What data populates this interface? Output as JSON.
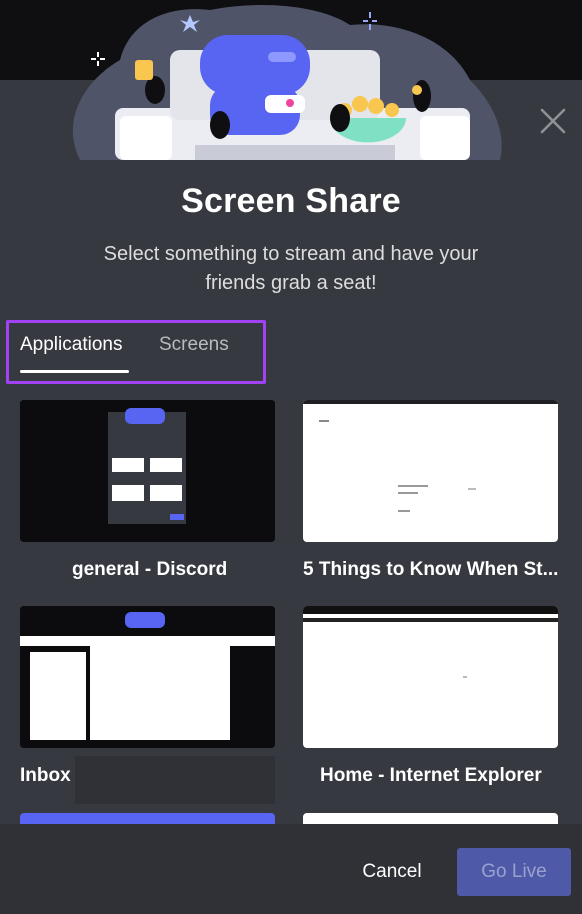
{
  "dialog": {
    "title": "Screen Share",
    "subtitle": "Select something to stream and have your friends grab a seat!"
  },
  "tabs": [
    {
      "label": "Applications",
      "selected": true
    },
    {
      "label": "Screens",
      "selected": false
    }
  ],
  "sources": [
    {
      "label": "general - Discord",
      "thumbnail": "dark"
    },
    {
      "label": "5 Things to Know When St...",
      "thumbnail": "white"
    },
    {
      "label": "Inbox",
      "thumbnail": "dark"
    },
    {
      "label": "Home - Internet Explorer",
      "thumbnail": "white"
    }
  ],
  "footer": {
    "cancel_label": "Cancel",
    "go_live_label": "Go Live"
  },
  "colors": {
    "background": "#36393f",
    "footer": "#2f3136",
    "highlight_box": "#a142f4",
    "go_live_button": "#4e5aa8",
    "blurple": "#5865f2"
  },
  "icons": {
    "close": "close-icon"
  }
}
